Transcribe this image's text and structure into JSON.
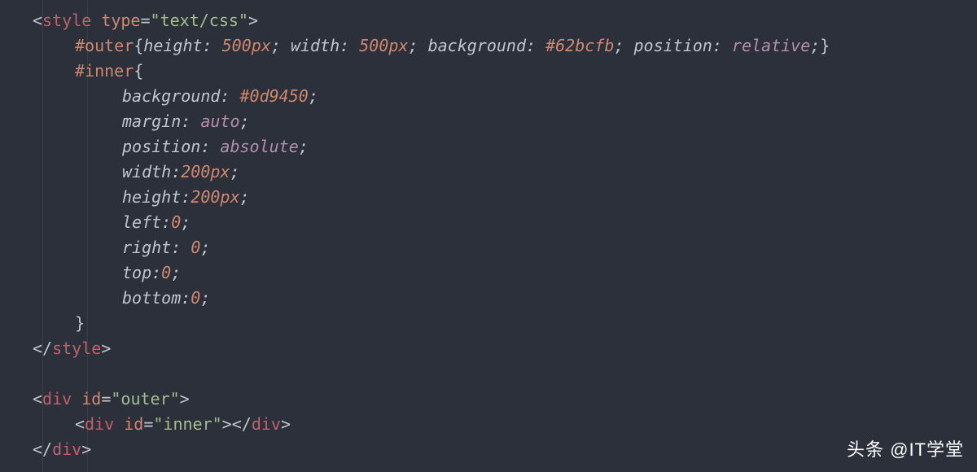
{
  "code": {
    "style_open": {
      "lt": "<",
      "tag": "style",
      "sp": " ",
      "attr": "type",
      "eq": "=",
      "q1": "\"",
      "val": "text/css",
      "q2": "\"",
      "gt": ">"
    },
    "outer_sel": "#outer",
    "outer_open": "{",
    "outer_rules": [
      {
        "prop": "height",
        "colon": ":",
        "sp": " ",
        "val": "500px",
        "semi": ";"
      },
      {
        "prop": "width",
        "colon": ":",
        "sp": " ",
        "val": "500px",
        "semi": ";"
      },
      {
        "prop": "background",
        "colon": ":",
        "sp": " ",
        "val": "#62bcfb",
        "semi": ";"
      },
      {
        "prop": "position",
        "colon": ":",
        "sp": " ",
        "val": "relative",
        "kw": true,
        "semi": ";"
      }
    ],
    "outer_close": "}",
    "inner_sel": "#inner",
    "inner_open": "{",
    "inner_rules": [
      {
        "prop": "background",
        "colon": ":",
        "sp": " ",
        "val": "#0d9450",
        "semi": ";"
      },
      {
        "prop": "margin",
        "colon": ":",
        "sp": " ",
        "val": "auto",
        "kw": true,
        "semi": ";"
      },
      {
        "prop": "position",
        "colon": ":",
        "sp": " ",
        "val": "absolute",
        "kw": true,
        "semi": ";"
      },
      {
        "prop": "width",
        "colon": ":",
        "sp": "",
        "val": "200px",
        "semi": ";"
      },
      {
        "prop": "height",
        "colon": ":",
        "sp": "",
        "val": "200px",
        "semi": ";"
      },
      {
        "prop": "left",
        "colon": ":",
        "sp": "",
        "val": "0",
        "semi": ";"
      },
      {
        "prop": "right",
        "colon": ":",
        "sp": " ",
        "val": "0",
        "semi": ";"
      },
      {
        "prop": "top",
        "colon": ":",
        "sp": "",
        "val": "0",
        "semi": ";"
      },
      {
        "prop": "bottom",
        "colon": ":",
        "sp": "",
        "val": "0",
        "semi": ";"
      }
    ],
    "inner_close": "}",
    "style_close": {
      "lt": "</",
      "tag": "style",
      "gt": ">"
    },
    "div_outer_open": {
      "lt": "<",
      "tag": "div",
      "sp": " ",
      "attr": "id",
      "eq": "=",
      "q1": "\"",
      "val": "outer",
      "q2": "\"",
      "gt": ">"
    },
    "div_inner": {
      "lt": "<",
      "tag": "div",
      "sp": " ",
      "attr": "id",
      "eq": "=",
      "q1": "\"",
      "val": "inner",
      "q2": "\"",
      "gt": ">",
      "clt": "</",
      "ctag": "div",
      "cgt": ">"
    },
    "div_outer_close": {
      "lt": "</",
      "tag": "div",
      "gt": ">"
    }
  },
  "watermark": "头条 @IT学堂"
}
